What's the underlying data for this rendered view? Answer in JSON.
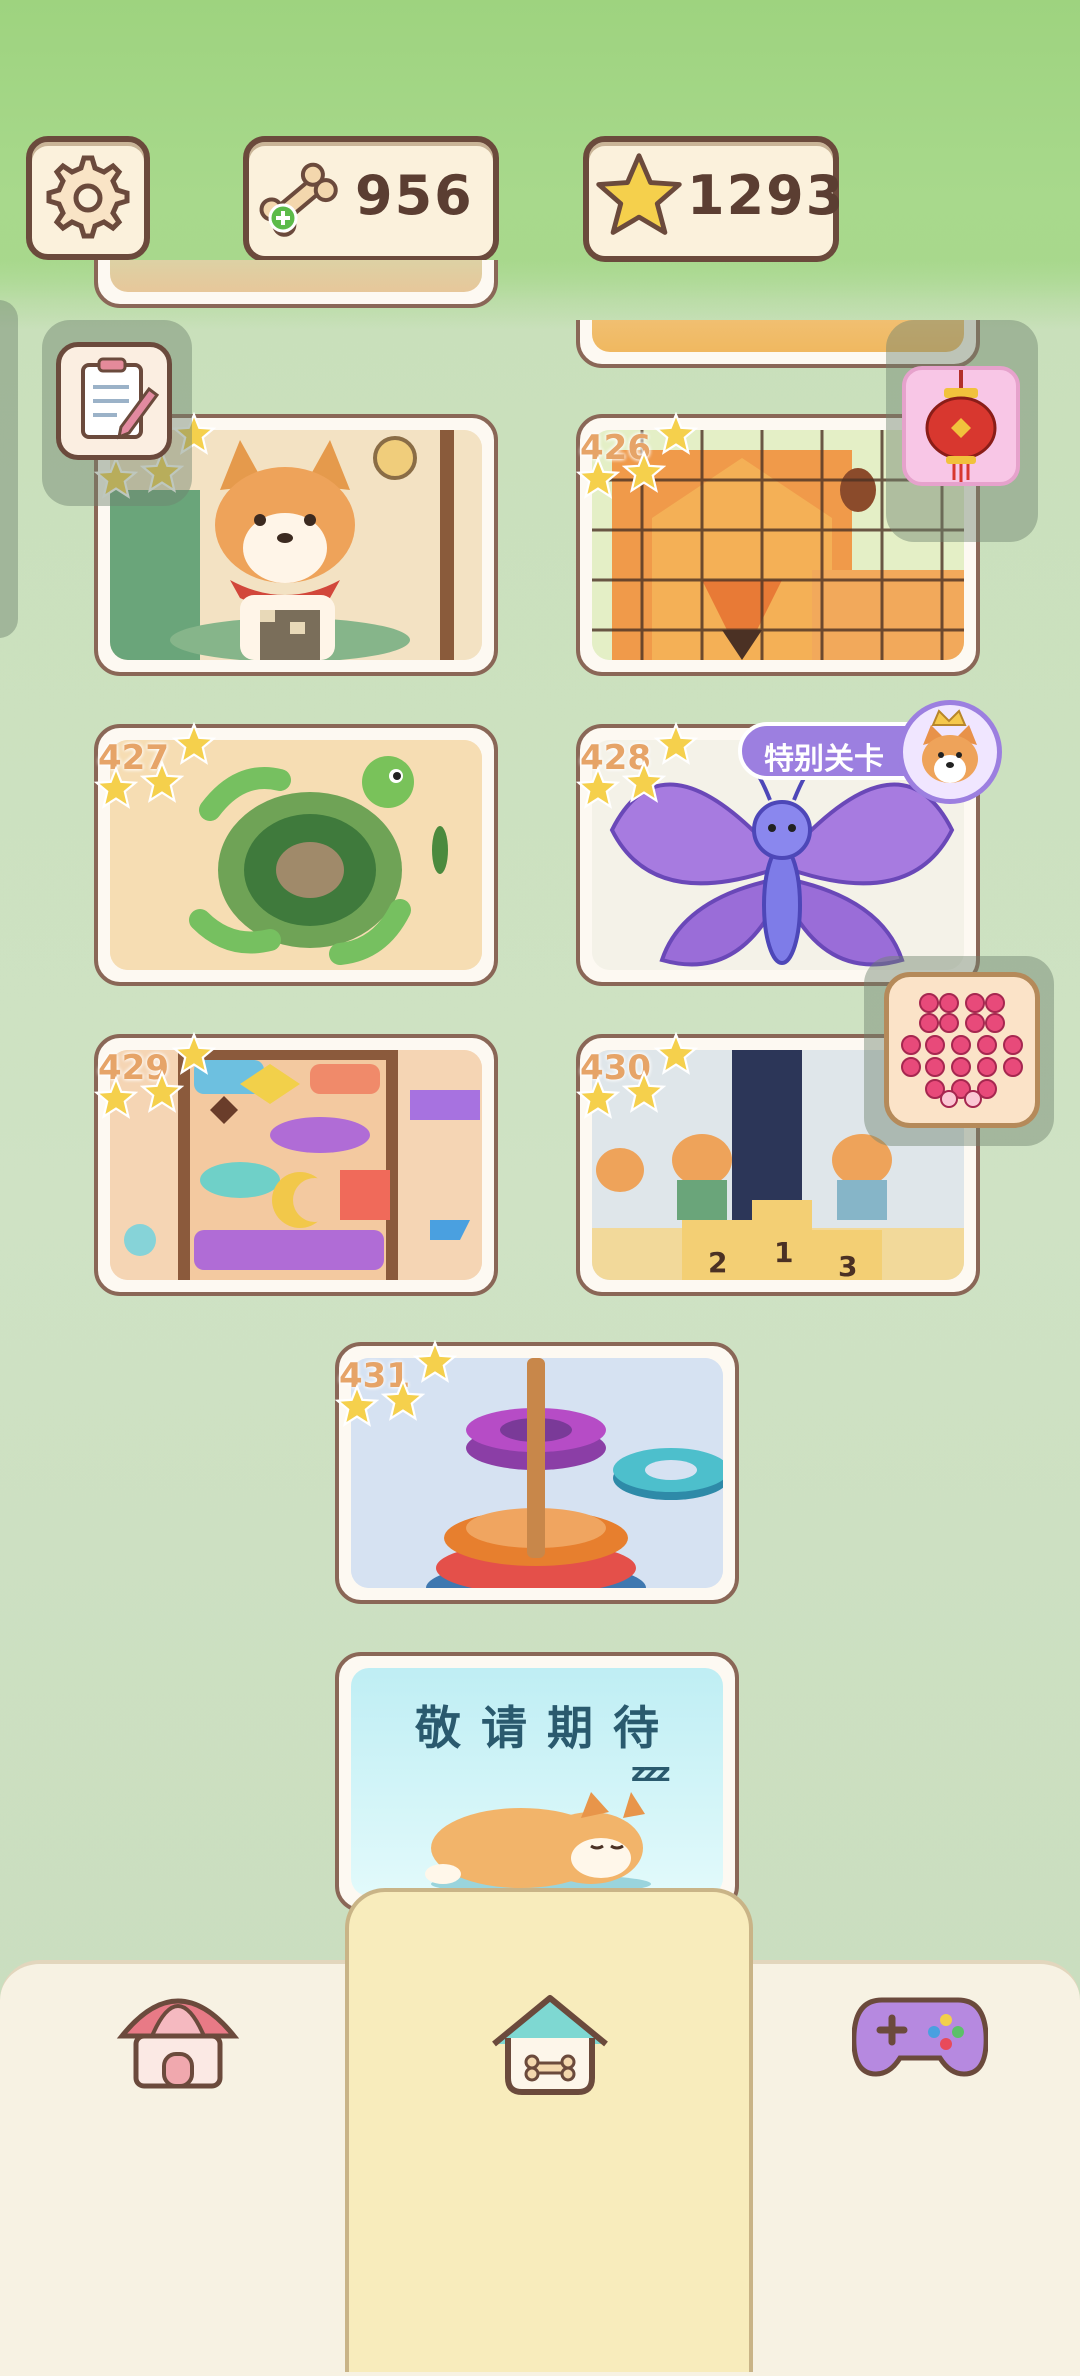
{
  "resources": {
    "bones": "956",
    "stars": "1293"
  },
  "levels": [
    {
      "number": "426",
      "theme": "lion"
    },
    {
      "number": "427",
      "theme": "turtle"
    },
    {
      "number": "428",
      "theme": "butterfly",
      "badge": "特别关卡"
    },
    {
      "number": "429",
      "theme": "blocks"
    },
    {
      "number": "430",
      "theme": "corgi-ceremony"
    },
    {
      "number": "431",
      "theme": "ring-stack"
    }
  ],
  "coming_soon": {
    "text": "敬请期待",
    "zzz": "z z z"
  },
  "nav": {
    "items": [
      {
        "name": "shop",
        "icon": "shop-icon"
      },
      {
        "name": "home",
        "icon": "home-icon"
      },
      {
        "name": "games",
        "icon": "gamepad-icon"
      }
    ]
  },
  "colors": {
    "card_border": "#8a6757",
    "level_number": "#e6a468",
    "star": "#f5d04c",
    "badge_bg": "#9c7fe0"
  }
}
